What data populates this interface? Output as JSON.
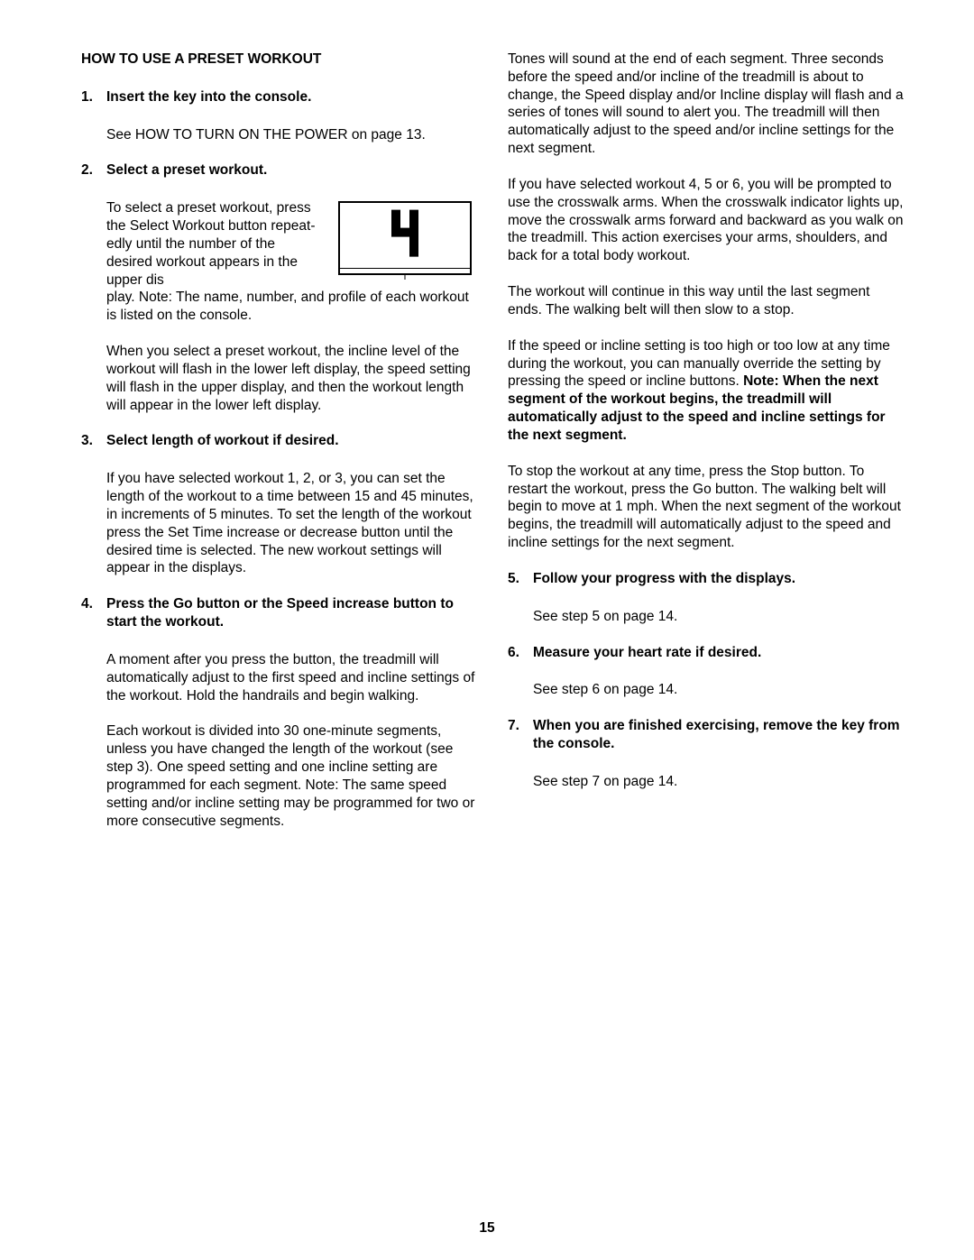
{
  "pageNumber": "15",
  "left": {
    "sectionTitle": "HOW TO USE A PRESET WORKOUT",
    "steps": [
      {
        "num": "1.",
        "head": "Insert the key into the console.",
        "body": [
          "See HOW TO TURN ON THE POWER on page 13."
        ]
      },
      {
        "num": "2.",
        "head": "Select a preset workout.",
        "wrapLead": "To select a preset work­out, press the Select Workout button repeat­edly until the number of the desired workout ap­pears in the upper dis­",
        "wrapTail": "play. Note: The name, number, and profile of each workout is listed on the console.",
        "body": [
          "When you select a preset workout, the incline level of the workout will flash in the lower left display, the speed setting will flash in the upper display, and then the workout length will appear in the lower left display."
        ]
      },
      {
        "num": "3.",
        "head": "Select length of workout if desired.",
        "body": [
          "If you have selected workout 1, 2, or 3, you can set the length of the workout to a time between 15 and 45 minutes, in increments of 5 minutes. To set the length of the workout press the Set Time increase or decrease button until the desired time is se­lected. The new workout settings will appear in the displays."
        ]
      },
      {
        "num": "4.",
        "head": "Press the Go button or the Speed increase but­ton to start the workout.",
        "body": [
          "A moment after you press the button, the treadmill will automatically adjust to the first speed and in­cline settings of the workout. Hold the handrails and begin walking.",
          "Each workout is divided into 30 one-minute seg­ments, unless you have changed the length of the workout (see step 3). One speed setting and one incline setting are programmed for each segment. Note: The same speed setting and/or incline setting may be programmed for two or more consecutive segments."
        ]
      }
    ]
  },
  "right": {
    "flow": [
      "Tones will sound at the end of each segment. Three seconds before the speed and/or incline of the treadmill is about to change, the Speed display and/or Incline display will flash and a series of tones will sound to alert you. The treadmill will then auto­matically adjust to the speed and/or incline settings for the next segment.",
      "If you have selected workout 4, 5 or 6, you will be prompted to use the crosswalk arms. When the crosswalk indicator lights up, move the crosswalk arms forward and backward as you walk on the treadmill. This action exercises your arms, shoul­ders, and back for a total body workout.",
      "The workout will continue in this way until the last segment ends. The walking belt will then slow to a stop."
    ],
    "mixed": {
      "pre": "If the speed or incline setting is too high or too low at any time during the workout, you can manually override the setting by pressing the speed or incline buttons. ",
      "bold": "Note: When the next segment of the workout begins, the treadmill will automatically adjust to the speed and incline settings for the next segment.",
      "post": ""
    },
    "flow2": [
      "To stop the workout at any time, press the Stop button. To restart the workout, press the Go button. The walking belt will begin to move at 1 mph. When the next segment of the workout begins, the tread­mill will automatically adjust to the speed and incline settings for the next segment."
    ],
    "steps": [
      {
        "num": "5.",
        "head": "Follow your progress with the displays.",
        "body": [
          "See step 5 on page 14."
        ]
      },
      {
        "num": "6.",
        "head": "Measure your heart rate if desired.",
        "body": [
          "See step 6 on page 14."
        ]
      },
      {
        "num": "7.",
        "head": "When you are finished exercising, remove the key from the console.",
        "body": [
          "See step 7 on page 14."
        ]
      }
    ]
  },
  "lcdDigit": "4"
}
